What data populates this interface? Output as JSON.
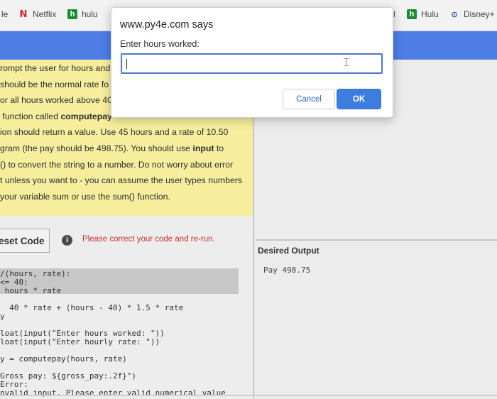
{
  "bookmarks": {
    "partial_left": "le",
    "netflix": "Netflix",
    "hulu": "hulu",
    "partial_mid": "l",
    "hulu2": "Hulu",
    "disney": "Disney+"
  },
  "instructions": {
    "lines": [
      "rompt the user for hours and",
      " should be the normal rate fo",
      "or all hours worked above 40",
      " function called computepay",
      "ion should return a value. Use 45 hours and a rate of 10.50",
      "gram (the pay should be 498.75). You should use input to",
      "() to convert the string to a number. Do not worry about error",
      "t unless you want to - you can assume the user types numbers",
      " your variable sum or use the sum() function."
    ],
    "bold_word_1": "computepay",
    "bold_word_2": "input"
  },
  "toolbar": {
    "reset_label": "eset Code",
    "error_message": "Please correct your code and re-run."
  },
  "code_lines": [
    "/(hours, rate):",
    "<= 40:",
    " hours * rate",
    "",
    "  40 * rate + (hours - 40) * 1.5 * rate",
    "y",
    "",
    "",
    "loat(input(\"Enter hours worked: \"))",
    "loat(input(\"Enter hourly rate: \"))",
    "",
    "y = computepay(hours, rate)",
    "",
    "Gross pay: ${gross_pay:.2f}\")",
    "Error:",
    "nvalid input. Please enter valid numerical value"
  ],
  "output": {
    "title": "Desired Output",
    "text": "Pay 498.75"
  },
  "dialog": {
    "title": "www.py4e.com says",
    "message": "Enter hours worked:",
    "input_value": "",
    "cancel_label": "Cancel",
    "ok_label": "OK"
  },
  "colors": {
    "header_blue": "#4e7de6",
    "instructions_yellow": "#f6ee9c",
    "ok_blue": "#3d7de0",
    "error_red": "#cc2f2f"
  },
  "icons": {
    "netflix": "netflix-icon",
    "hulu": "hulu-icon",
    "disney": "disney-icon",
    "info": "info-icon",
    "text_cursor": "text-cursor-icon"
  }
}
